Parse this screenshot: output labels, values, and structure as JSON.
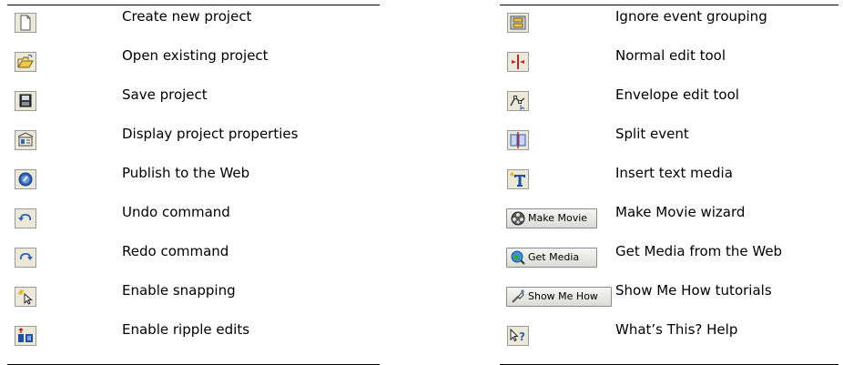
{
  "left_column": {
    "items": [
      {
        "icon": "new-document-icon",
        "label": "Create new project"
      },
      {
        "icon": "open-folder-icon",
        "label": "Open existing project"
      },
      {
        "icon": "floppy-disk-icon",
        "label": "Save project"
      },
      {
        "icon": "project-properties-icon",
        "label": "Display project properties"
      },
      {
        "icon": "publish-web-icon",
        "label": "Publish to the Web"
      },
      {
        "icon": "undo-icon",
        "label": "Undo command"
      },
      {
        "icon": "redo-icon",
        "label": "Redo command"
      },
      {
        "icon": "snapping-icon",
        "label": "Enable snapping"
      },
      {
        "icon": "ripple-edit-icon",
        "label": "Enable ripple edits"
      }
    ]
  },
  "right_column": {
    "items": [
      {
        "icon": "ignore-grouping-icon",
        "label": "Ignore event grouping"
      },
      {
        "icon": "normal-edit-icon",
        "label": "Normal edit tool"
      },
      {
        "icon": "envelope-edit-icon",
        "label": "Envelope edit tool"
      },
      {
        "icon": "split-event-icon",
        "label": "Split event"
      },
      {
        "icon": "insert-text-icon",
        "label": "Insert text media"
      },
      {
        "icon": "make-movie-icon",
        "button_text": "Make Movie",
        "label": "Make Movie wizard"
      },
      {
        "icon": "get-media-icon",
        "button_text": "Get Media",
        "label": "Get Media from the Web"
      },
      {
        "icon": "show-me-how-icon",
        "button_text": "Show Me How",
        "label": "Show Me How tutorials"
      },
      {
        "icon": "whats-this-help-icon",
        "label": "What’s This? Help"
      }
    ]
  },
  "colors": {
    "text": "#000000",
    "rule": "#000000",
    "button_face": "#ece9d8",
    "icon_blue": "#2f5fb3",
    "icon_red": "#c8202a"
  }
}
